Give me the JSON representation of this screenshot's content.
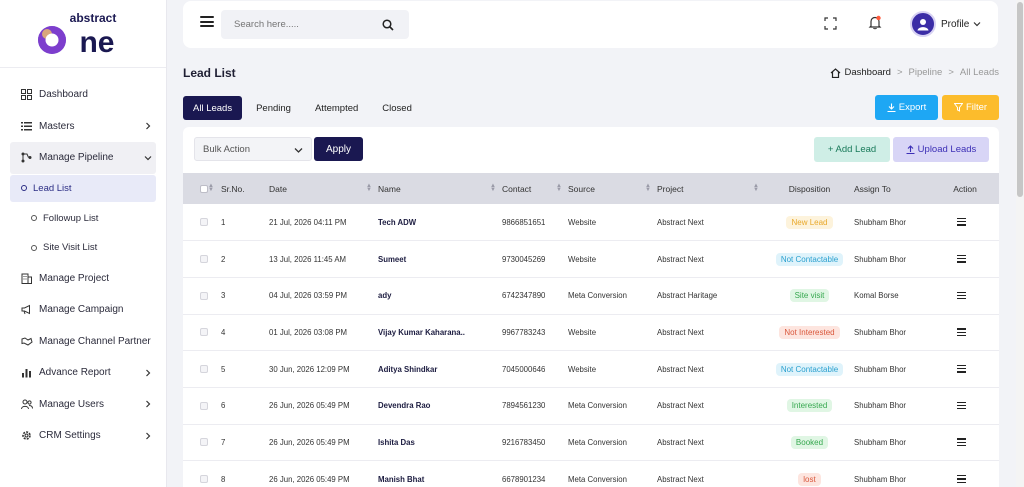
{
  "logo": {
    "top_text": "abstract",
    "main_text": "one"
  },
  "sidebar": {
    "items": [
      {
        "label": "Dashboard",
        "icon": "dashboard-icon",
        "has_chevron": false
      },
      {
        "label": "Masters",
        "icon": "list-icon",
        "has_chevron": true
      },
      {
        "label": "Manage Pipeline",
        "icon": "pipeline-icon",
        "has_chevron": true,
        "open": true
      },
      {
        "label": "Manage Project",
        "icon": "building-icon",
        "has_chevron": false
      },
      {
        "label": "Manage Campaign",
        "icon": "megaphone-icon",
        "has_chevron": false
      },
      {
        "label": "Manage Channel Partner",
        "icon": "handshake-icon",
        "has_chevron": false
      },
      {
        "label": "Advance Report",
        "icon": "chart-icon",
        "has_chevron": true
      },
      {
        "label": "Manage Users",
        "icon": "users-icon",
        "has_chevron": true
      },
      {
        "label": "CRM Settings",
        "icon": "gear-icon",
        "has_chevron": true
      }
    ],
    "subitems": [
      {
        "label": "Lead List",
        "active": true
      },
      {
        "label": "Followup List",
        "active": false
      },
      {
        "label": "Site Visit List",
        "active": false
      }
    ]
  },
  "header": {
    "search_placeholder": "Search here.....",
    "profile_label": "Profile"
  },
  "page": {
    "title": "Lead List",
    "breadcrumb": [
      "Dashboard",
      "Pipeline",
      "All Leads"
    ],
    "breadcrumb_sep": ">"
  },
  "tabs": [
    {
      "label": "All Leads",
      "active": true
    },
    {
      "label": "Pending",
      "active": false
    },
    {
      "label": "Attempted",
      "active": false
    },
    {
      "label": "Closed",
      "active": false
    }
  ],
  "actions": {
    "export_label": "Export",
    "filter_label": "Filter",
    "bulk_label": "Bulk Action",
    "apply_label": "Apply",
    "add_label": "+ Add Lead",
    "upload_label": "Upload Leads"
  },
  "table": {
    "columns": [
      "Sr.No.",
      "Date",
      "Name",
      "Contact",
      "Source",
      "Project",
      "Disposition",
      "Assign To",
      "Action"
    ],
    "rows": [
      {
        "sr": "1",
        "date": "21 Jul, 2026 04:11 PM",
        "name": "Tech ADW",
        "contact": "9866851651",
        "source": "Website",
        "project": "Abstract Next",
        "disposition": "New Lead",
        "assign": "Shubham Bhor"
      },
      {
        "sr": "2",
        "date": "13 Jul, 2026 11:45 AM",
        "name": "Sumeet",
        "contact": "9730045269",
        "source": "Website",
        "project": "Abstract Next",
        "disposition": "Not Contactable",
        "assign": "Shubham Bhor"
      },
      {
        "sr": "3",
        "date": "04 Jul, 2026 03:59 PM",
        "name": "ady",
        "contact": "6742347890",
        "source": "Meta Conversion",
        "project": "Abstract Haritage",
        "disposition": "Site visit",
        "assign": "Komal Borse"
      },
      {
        "sr": "4",
        "date": "01 Jul, 2026 03:08 PM",
        "name": "Vijay Kumar Kaharana..",
        "contact": "9967783243",
        "source": "Website",
        "project": "Abstract Next",
        "disposition": "Not Interested",
        "assign": "Shubham Bhor"
      },
      {
        "sr": "5",
        "date": "30 Jun, 2026 12:09 PM",
        "name": "Aditya Shindkar",
        "contact": "7045000646",
        "source": "Website",
        "project": "Abstract Next",
        "disposition": "Not Contactable",
        "assign": "Shubham Bhor"
      },
      {
        "sr": "6",
        "date": "26 Jun, 2026 05:49 PM",
        "name": "Devendra Rao",
        "contact": "7894561230",
        "source": "Meta Conversion",
        "project": "Abstract Next",
        "disposition": "Interested",
        "assign": "Shubham Bhor"
      },
      {
        "sr": "7",
        "date": "26 Jun, 2026 05:49 PM",
        "name": "Ishita Das",
        "contact": "9216783450",
        "source": "Meta Conversion",
        "project": "Abstract Next",
        "disposition": "Booked",
        "assign": "Shubham Bhor"
      },
      {
        "sr": "8",
        "date": "26 Jun, 2026 05:49 PM",
        "name": "Manish Bhat",
        "contact": "6678901234",
        "source": "Meta Conversion",
        "project": "Abstract Next",
        "disposition": "lost",
        "assign": "Shubham Bhor"
      }
    ]
  },
  "colors": {
    "primary": "#1a1851",
    "export": "#1ea7f4",
    "filter": "#fcbc2c",
    "New Lead": {
      "bg": "#fdf3dc",
      "fg": "#e9a82a"
    },
    "Not Contactable": {
      "bg": "#dff3fb",
      "fg": "#2aa0cf"
    },
    "Site visit": {
      "bg": "#e0f6e4",
      "fg": "#36a84f"
    },
    "Not Interested": {
      "bg": "#fde5df",
      "fg": "#d9573b"
    },
    "Interested": {
      "bg": "#e0f6e4",
      "fg": "#36a84f"
    },
    "Booked": {
      "bg": "#e0f6e4",
      "fg": "#36a84f"
    },
    "lost": {
      "bg": "#fde5df",
      "fg": "#d9573b"
    }
  }
}
